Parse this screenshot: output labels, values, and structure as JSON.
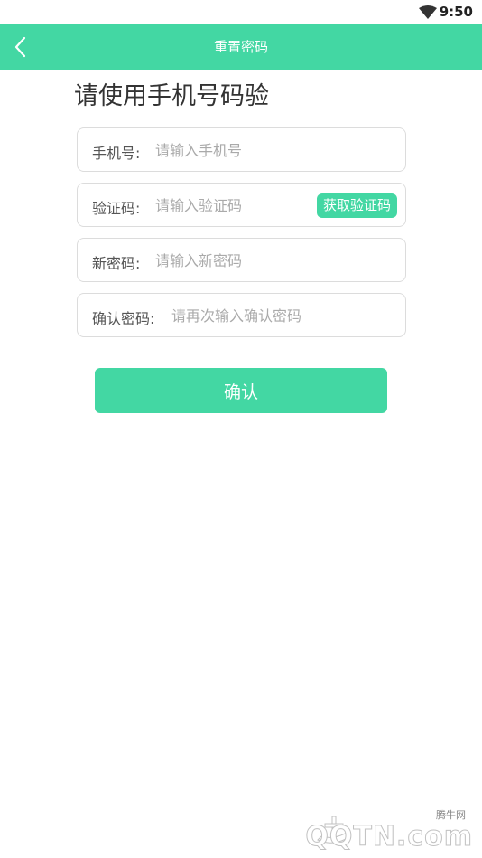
{
  "status_bar": {
    "time": "9:50"
  },
  "app_bar": {
    "title": "重置密码"
  },
  "heading": "请使用手机号码验",
  "form": {
    "phone": {
      "label": "手机号:",
      "placeholder": "请输入手机号"
    },
    "code": {
      "label": "验证码:",
      "placeholder": "请输入验证码",
      "button": "获取验证码"
    },
    "new_password": {
      "label": "新密码:",
      "placeholder": "请输入新密码"
    },
    "confirm_password": {
      "label": "确认密码:",
      "placeholder": "请再次输入确认密码"
    }
  },
  "confirm_button": "确认",
  "watermark": {
    "small": "腾牛网",
    "big": "QQTN.com"
  },
  "colors": {
    "accent": "#43d7a3",
    "border": "#dcdcdc",
    "placeholder": "#aaaaaa"
  }
}
